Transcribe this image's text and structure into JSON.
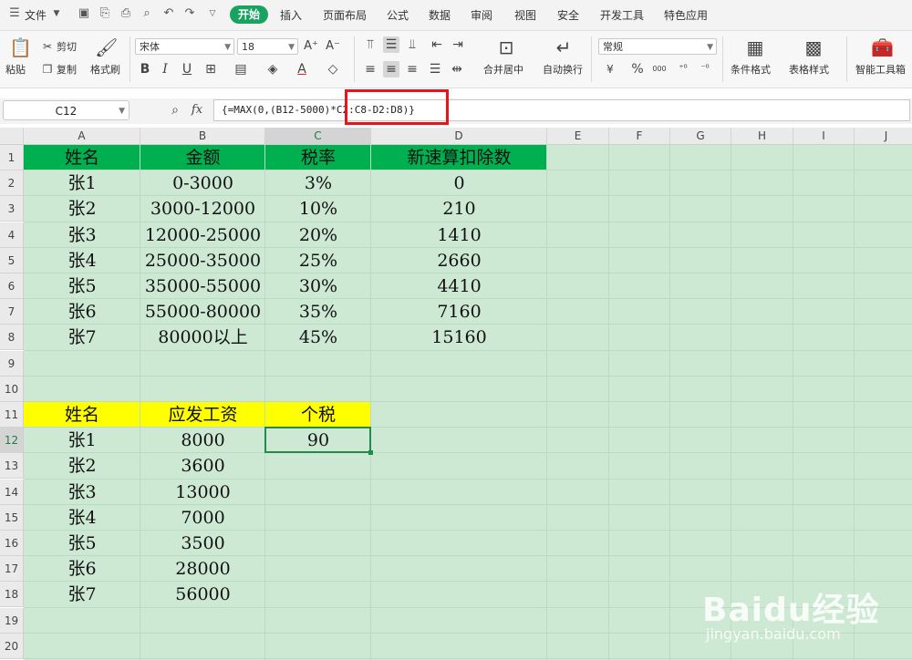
{
  "menu": {
    "file": "文件",
    "tabs": [
      "开始",
      "插入",
      "页面布局",
      "公式",
      "数据",
      "审阅",
      "视图",
      "安全",
      "开发工具",
      "特色应用"
    ]
  },
  "ribbon": {
    "paste": "粘贴",
    "cut": "剪切",
    "copy": "复制",
    "format_painter": "格式刷",
    "font_name": "宋体",
    "font_size": "18",
    "merge_center": "合并居中",
    "wrap_text": "自动换行",
    "number_format": "常规",
    "percent": "%",
    "thousands": "000",
    "cond_format": "条件格式",
    "table_style": "表格样式",
    "smart_toolbox": "智能工具箱"
  },
  "formula_bar": {
    "name_box": "C12",
    "fx": "fx",
    "formula": "{=MAX(0,(B12-5000)*C2:C8-D2:D8)}"
  },
  "columns": [
    "A",
    "B",
    "C",
    "D",
    "E",
    "F",
    "G",
    "H",
    "I",
    "J"
  ],
  "rows": [
    "1",
    "2",
    "3",
    "4",
    "5",
    "6",
    "7",
    "8",
    "9",
    "10",
    "11",
    "12",
    "13",
    "14",
    "15",
    "16",
    "17",
    "18",
    "19",
    "20"
  ],
  "table1": {
    "headers": [
      "姓名",
      "金额",
      "税率",
      "新速算扣除数"
    ],
    "rows": [
      [
        "张1",
        "0-3000",
        "3%",
        "0"
      ],
      [
        "张2",
        "3000-12000",
        "10%",
        "210"
      ],
      [
        "张3",
        "12000-25000",
        "20%",
        "1410"
      ],
      [
        "张4",
        "25000-35000",
        "25%",
        "2660"
      ],
      [
        "张5",
        "35000-55000",
        "30%",
        "4410"
      ],
      [
        "张6",
        "55000-80000",
        "35%",
        "7160"
      ],
      [
        "张7",
        "80000以上",
        "45%",
        "15160"
      ]
    ]
  },
  "table2": {
    "headers": [
      "姓名",
      "应发工资",
      "个税"
    ],
    "rows": [
      [
        "张1",
        "8000",
        "90"
      ],
      [
        "张2",
        "3600",
        ""
      ],
      [
        "张3",
        "13000",
        ""
      ],
      [
        "张4",
        "7000",
        ""
      ],
      [
        "张5",
        "3500",
        ""
      ],
      [
        "张6",
        "28000",
        ""
      ],
      [
        "张7",
        "56000",
        ""
      ]
    ]
  },
  "colors": {
    "header1_fill": "#00b050",
    "header2_fill": "#ffff00",
    "grid_bg": "#cde9d4",
    "tab_active": "#1aa260",
    "highlight_box": "#e8141c"
  },
  "watermark": {
    "main": "Baidu经验",
    "sub": "jingyan.baidu.com"
  }
}
